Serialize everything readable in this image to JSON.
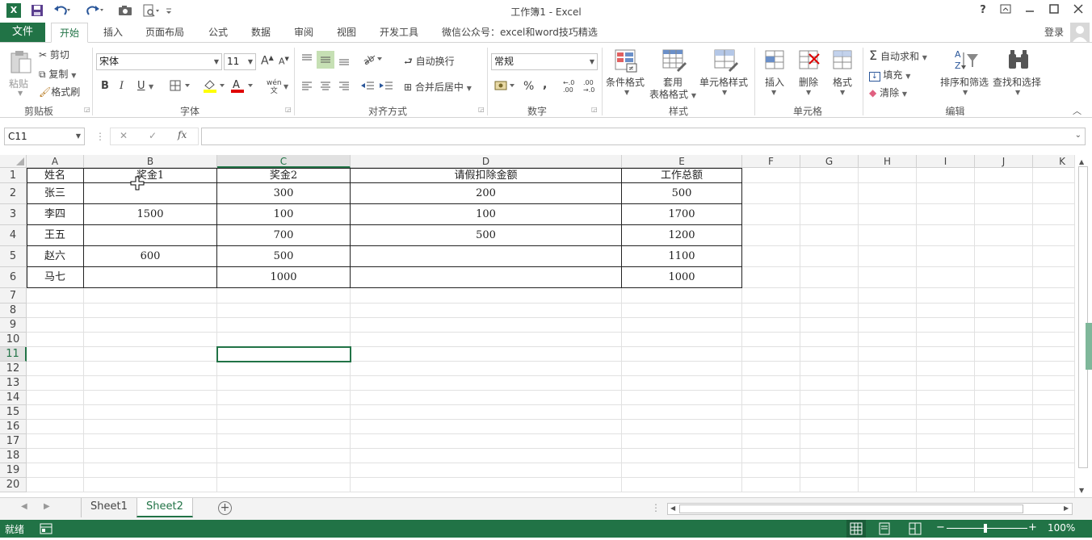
{
  "window": {
    "title": "工作簿1 - Excel",
    "help": "?",
    "buttons": {
      "restore": "⧉",
      "minimize": "—",
      "maximize": "☐",
      "close": "✕"
    }
  },
  "quick_access": {
    "save_icon": "save-icon",
    "undo_icon": "undo-icon",
    "redo_icon": "redo-icon"
  },
  "tabs": {
    "file": "文件",
    "items": [
      "开始",
      "插入",
      "页面布局",
      "公式",
      "数据",
      "审阅",
      "视图",
      "开发工具",
      "微信公众号：excel和word技巧精选"
    ],
    "active": "开始",
    "login": "登录"
  },
  "ribbon": {
    "clipboard": {
      "paste": "粘贴",
      "cut": "剪切",
      "copy": "复制",
      "format_painter": "格式刷",
      "label": "剪贴板"
    },
    "font": {
      "name": "宋体",
      "size": "11",
      "bold": "B",
      "italic": "I",
      "underline": "U",
      "grow": "A",
      "shrink": "A",
      "phonetic": "wén",
      "label": "字体"
    },
    "alignment": {
      "wrap": "自动换行",
      "merge": "合并后居中",
      "label": "对齐方式"
    },
    "number": {
      "format": "常规",
      "percent": "%",
      "comma": ",",
      "label": "数字"
    },
    "styles": {
      "conditional": "条件格式",
      "table_line1": "套用",
      "table_line2": "表格格式",
      "cell_styles": "单元格样式",
      "label": "样式"
    },
    "cells": {
      "insert": "插入",
      "delete": "删除",
      "format": "格式",
      "label": "单元格"
    },
    "editing": {
      "autosum": "自动求和",
      "fill": "填充",
      "clear": "清除",
      "sort": "排序和筛选",
      "find": "查找和选择",
      "label": "编辑"
    }
  },
  "formula_bar": {
    "name_box": "C11",
    "cancel": "✕",
    "enter": "✓",
    "fx": "fx",
    "value": ""
  },
  "sheet": {
    "columns": [
      "A",
      "B",
      "C",
      "D",
      "E",
      "F",
      "G",
      "H",
      "I",
      "J",
      "K"
    ],
    "rows": [
      "1",
      "2",
      "3",
      "4",
      "5",
      "6",
      "7",
      "8",
      "9",
      "10",
      "11",
      "12",
      "13",
      "14",
      "15",
      "16",
      "17",
      "18",
      "19",
      "20"
    ],
    "selected_column": "C",
    "selected_row": "11",
    "table": [
      [
        "姓名",
        "奖金1",
        "奖金2",
        "请假扣除金额",
        "工作总额"
      ],
      [
        "张三",
        "",
        "300",
        "200",
        "500"
      ],
      [
        "李四",
        "1500",
        "100",
        "100",
        "1700"
      ],
      [
        "王五",
        "",
        "700",
        "500",
        "1200"
      ],
      [
        "赵六",
        "600",
        "500",
        "",
        "1100"
      ],
      [
        "马七",
        "",
        "1000",
        "",
        "1000"
      ]
    ]
  },
  "sheet_tabs": {
    "items": [
      "Sheet1",
      "Sheet2"
    ],
    "active": "Sheet2",
    "add": "+"
  },
  "status": {
    "ready": "就绪",
    "zoom": "100%",
    "zoom_minus": "−",
    "zoom_plus": "+"
  },
  "colors": {
    "accent": "#217346",
    "grid_line": "#e1e1e1",
    "header_bg": "#f3f3f3"
  }
}
